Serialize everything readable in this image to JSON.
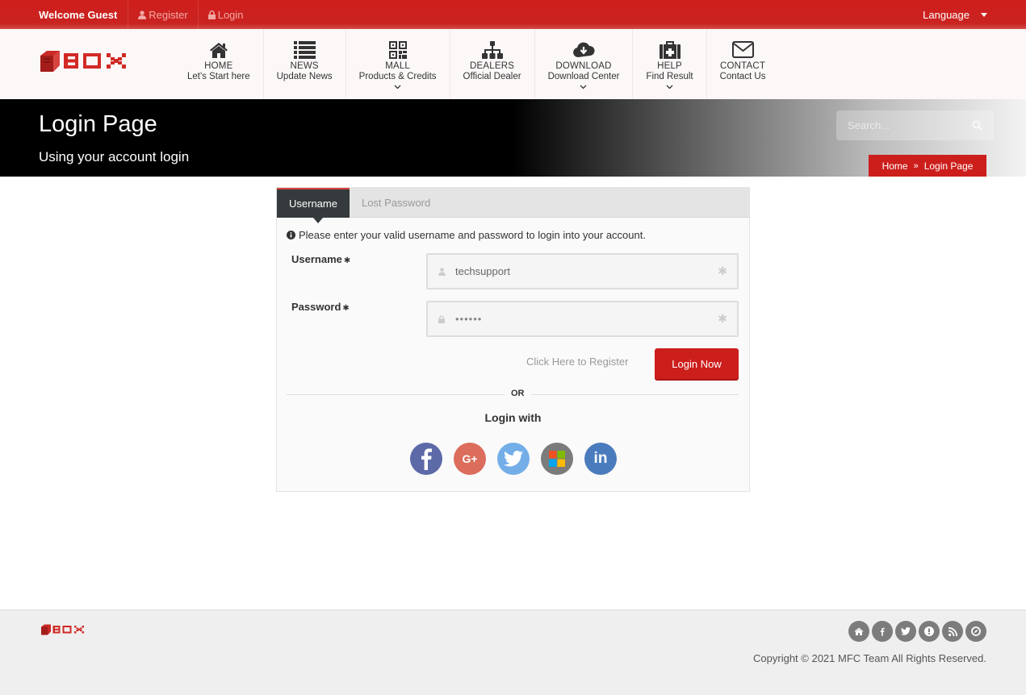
{
  "topbar": {
    "welcome": "Welcome Guest",
    "register": "Register",
    "login": "Login",
    "language": "Language"
  },
  "brand": {
    "logo_text": "BOX",
    "color": "#cc1f1c"
  },
  "nav": [
    {
      "title": "HOME",
      "subtitle": "Let's Start here",
      "icon": "home-icon",
      "dropdown": false
    },
    {
      "title": "NEWS",
      "subtitle": "Update News",
      "icon": "list-icon",
      "dropdown": false
    },
    {
      "title": "MALL",
      "subtitle": "Products & Credits",
      "icon": "qrcode-icon",
      "dropdown": true
    },
    {
      "title": "DEALERS",
      "subtitle": "Official Dealer",
      "icon": "sitemap-icon",
      "dropdown": false
    },
    {
      "title": "DOWNLOAD",
      "subtitle": "Download Center",
      "icon": "cloud-download-icon",
      "dropdown": true
    },
    {
      "title": "HELP",
      "subtitle": "Find Result",
      "icon": "medkit-icon",
      "dropdown": true
    },
    {
      "title": "CONTACT",
      "subtitle": "Contact Us",
      "icon": "envelope-icon",
      "dropdown": false
    }
  ],
  "hero": {
    "title": "Login Page",
    "subtitle": "Using your account login",
    "search_placeholder": "Search...",
    "breadcrumb": [
      "Home",
      "Login Page"
    ]
  },
  "login": {
    "tabs": [
      "Username",
      "Lost Password"
    ],
    "info": "Please enter your valid username and password to login into your account.",
    "username_label": "Username",
    "username_value": "techsupport",
    "password_label": "Password",
    "password_value": "••••••",
    "register_link": "Click Here to Register",
    "submit": "Login Now",
    "or": "OR",
    "login_with": "Login with",
    "socials": [
      {
        "name": "facebook",
        "color": "#5c6aa7"
      },
      {
        "name": "google-plus",
        "color": "#dc6c5b"
      },
      {
        "name": "twitter",
        "color": "#73aee8"
      },
      {
        "name": "microsoft",
        "color": "#7b7b7b"
      },
      {
        "name": "linkedin",
        "color": "#4a7cbd"
      }
    ]
  },
  "footer": {
    "copyright": "Copyright © 2021 MFC Team All Rights Reserved.",
    "icons": [
      "home",
      "facebook",
      "twitter",
      "alert",
      "rss",
      "compass"
    ]
  }
}
